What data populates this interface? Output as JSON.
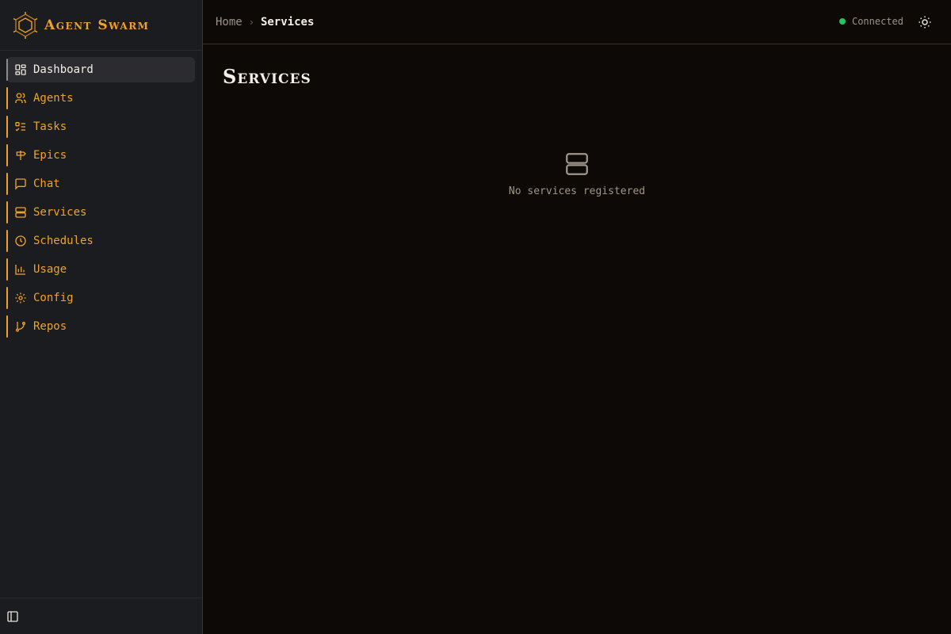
{
  "brand": {
    "name": "Agent Swarm",
    "accent": "#f0a227"
  },
  "sidebar": {
    "items": [
      {
        "label": "Dashboard",
        "icon": "dashboard-icon",
        "active": true
      },
      {
        "label": "Agents",
        "icon": "users-icon"
      },
      {
        "label": "Tasks",
        "icon": "tasks-icon"
      },
      {
        "label": "Epics",
        "icon": "signpost-icon"
      },
      {
        "label": "Chat",
        "icon": "chat-icon"
      },
      {
        "label": "Services",
        "icon": "server-icon"
      },
      {
        "label": "Schedules",
        "icon": "clock-icon"
      },
      {
        "label": "Usage",
        "icon": "bar-chart-icon"
      },
      {
        "label": "Config",
        "icon": "gear-icon"
      },
      {
        "label": "Repos",
        "icon": "git-branch-icon"
      }
    ],
    "footer_icon": "sidebar-toggle-icon"
  },
  "topbar": {
    "breadcrumb": {
      "home": "Home",
      "current": "Services"
    },
    "status": {
      "label": "Connected",
      "color": "#22c55e"
    },
    "theme_icon": "sun-icon"
  },
  "main": {
    "title": "Services",
    "empty_icon": "server-icon",
    "empty_text": "No services registered"
  }
}
